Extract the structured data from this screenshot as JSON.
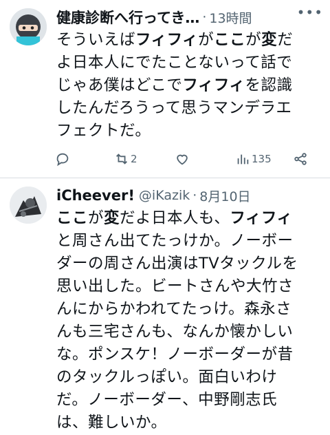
{
  "tweets": [
    {
      "display_name": "健康診断へ行ってき…",
      "handle": "",
      "time": "13時間",
      "text_lines": [
        [
          {
            "t": "そういえば"
          },
          {
            "t": "フィフィ",
            "b": true
          },
          {
            "t": "が"
          },
          {
            "t": "ここ",
            "b": true
          },
          {
            "t": "が"
          },
          {
            "t": "変",
            "b": true
          },
          {
            "t": "だ"
          }
        ],
        [
          {
            "t": "よ日本人にでたことないって話で"
          }
        ],
        [
          {
            "t": "じゃあ僕はどこで"
          },
          {
            "t": "フィフィ",
            "b": true
          },
          {
            "t": "を認識"
          }
        ],
        [
          {
            "t": "したんだろうって思うマンデラエ"
          }
        ],
        [
          {
            "t": "フェクトだ。"
          }
        ]
      ],
      "actions": {
        "replies": "",
        "reposts": "2",
        "likes": "",
        "views": "135"
      }
    },
    {
      "display_name": "iCheever!",
      "handle": "@iKazik",
      "time": "8月10日",
      "text_lines": [
        [
          {
            "t": "ここ",
            "b": true
          },
          {
            "t": "が"
          },
          {
            "t": "変",
            "b": true
          },
          {
            "t": "だよ日本人も、"
          },
          {
            "t": "フィフィ",
            "b": true
          }
        ],
        [
          {
            "t": "と周さん出てたっけか。ノーボー"
          }
        ],
        [
          {
            "t": "ダーの周さん出演はTVタックルを"
          }
        ],
        [
          {
            "t": "思い出した。ビートさんや大竹さ"
          }
        ],
        [
          {
            "t": "んにからかわれてたっけ。森永さ"
          }
        ],
        [
          {
            "t": "んも三宅さんも、なんか懐かしい"
          }
        ],
        [
          {
            "t": "な。ポンスケ！ノーボーダーが昔"
          }
        ],
        [
          {
            "t": "のタックルっぽい。面白いわけ"
          }
        ],
        [
          {
            "t": "だ。ノーボーダー、中野剛志氏"
          }
        ],
        [
          {
            "t": "は、難しいか。"
          }
        ]
      ]
    }
  ],
  "colors": {
    "text": "#0f1419",
    "muted": "#536471",
    "divider": "#d9dde1"
  },
  "icons": [
    "avatar-ninja-icon",
    "more-icon",
    "reply-icon",
    "repost-icon",
    "like-icon",
    "views-icon",
    "share-icon",
    "avatar-photo-icon"
  ]
}
